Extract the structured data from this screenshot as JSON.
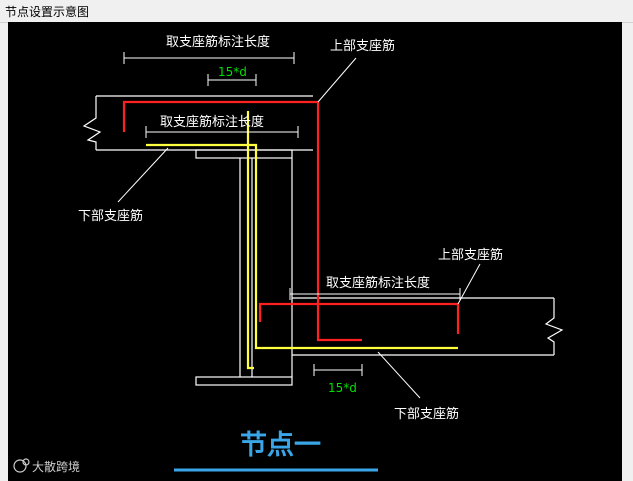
{
  "window": {
    "title": "节点设置示意图"
  },
  "diagram": {
    "top_dim_label": "取支座筋标注长度",
    "top_inner_dim_label": "取支座筋标注长度",
    "top_anchor_label": "15*d",
    "top_upper_bar_label": "上部支座筋",
    "top_lower_bar_label": "下部支座筋",
    "bottom_upper_bar_label": "上部支座筋",
    "bottom_dim_label": "取支座筋标注长度",
    "bottom_anchor_label": "15*d",
    "bottom_lower_bar_label": "下部支座筋",
    "node_title": "节点一",
    "watermark": "大散跨境",
    "colors": {
      "background": "#000000",
      "structure": "#ffffff",
      "upper_bar": "#ff2020",
      "lower_bar": "#ffff40",
      "anchor_dim": "#00e000",
      "title": "#3aa6e8"
    }
  }
}
